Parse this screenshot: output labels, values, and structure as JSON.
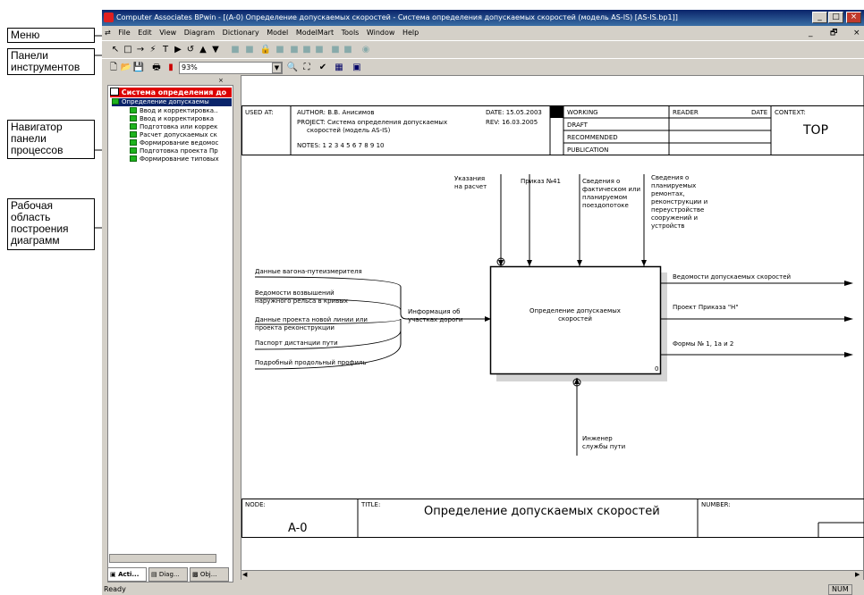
{
  "callouts": {
    "menu": "Меню",
    "toolbars": "Панели\nинструментов",
    "navigator": "Навигатор\nпанели\nпроцессов",
    "workarea": "Рабочая\nобласть\nпостроения\nдиаграмм"
  },
  "window": {
    "title": "Computer Associates BPwin - [(A-0) Определение допускаемых скоростей - Система определения допускаемых скоростей (модель AS-IS)  [AS-IS.bp1]]",
    "menu": [
      "File",
      "Edit",
      "View",
      "Diagram",
      "Dictionary",
      "Model",
      "ModelMart",
      "Tools",
      "Window",
      "Help"
    ],
    "zoom": "93%",
    "status": "Ready",
    "num": "NUM"
  },
  "navigator": {
    "root": "Система определения до",
    "items": [
      "Определение допускаемы",
      "Ввод и корректировка..",
      "Ввод и корректировка",
      "Подготовка или коррек",
      "Расчет допускаемых ск",
      "Формирование ведомос",
      "Подготовка проекта Пр",
      "Формирование типовых"
    ],
    "tabs": [
      "Acti...",
      "Diag...",
      "Obj..."
    ]
  },
  "header": {
    "used_at": "USED AT:",
    "author": "AUTHOR:  В.В. Анисимов",
    "project": "PROJECT:  Система определения допускаемых",
    "project2": "скоростей (модель AS-IS)",
    "notes": "NOTES:  1  2  3  4  5  6  7  8  9  10",
    "date": "DATE:  15.05.2003",
    "rev": "REV:   16.03.2005",
    "working": "WORKING",
    "draft": "DRAFT",
    "recommended": "RECOMMENDED",
    "publication": "PUBLICATION",
    "reader": "READER",
    "date2": "DATE",
    "context": "CONTEXT:",
    "top": "TOP"
  },
  "diagram": {
    "box": "Определение допускаемых скоростей",
    "box_num": "0",
    "controls": [
      "Указания на расчет",
      "Приказ №41",
      "Сведения о фактическом или планируемом поездопотоке",
      "Сведения о планируемых ремонтах, реконструкции и переустройстве сооружений и устройств"
    ],
    "inputs": [
      "Данные вагона-путеизмерителя",
      "Ведомости возвышений наружного рельса в кривых",
      "Данные проекта новой линии или проекта реконструкции",
      "Паспорт дистанции пути",
      "Подробный продольный профиль"
    ],
    "merged_input": "Информация об участках дороги",
    "outputs": [
      "Ведомости допускаемых скоростей",
      "Проект Приказа \"Н\"",
      "Формы № 1, 1а и 2"
    ],
    "mechanism": "Инженер службы пути"
  },
  "footer": {
    "node": "NODE:",
    "node_val": "A-0",
    "title": "TITLE:",
    "title_val": "Определение допускаемых скоростей",
    "number": "NUMBER:"
  }
}
